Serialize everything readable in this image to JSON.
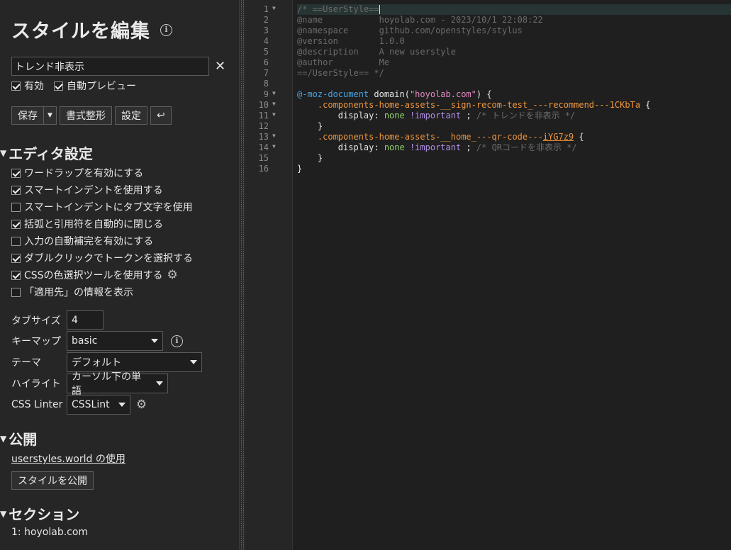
{
  "sidebar": {
    "title": "スタイルを編集",
    "name_value": "トレンド非表示",
    "toggles": [
      {
        "label": "有効",
        "checked": true
      },
      {
        "label": "自動プレビュー",
        "checked": true
      }
    ],
    "buttons": {
      "save": "保存",
      "beautify": "書式整形",
      "settings": "設定",
      "undo": "↩"
    },
    "editor_settings": {
      "heading": "エディタ設定",
      "options": [
        {
          "label": "ワードラップを有効にする",
          "checked": true
        },
        {
          "label": "スマートインデントを使用する",
          "checked": true
        },
        {
          "label": "スマートインデントにタブ文字を使用",
          "checked": false
        },
        {
          "label": "括弧と引用符を自動的に閉じる",
          "checked": true
        },
        {
          "label": "入力の自動補完を有効にする",
          "checked": false
        },
        {
          "label": "ダブルクリックでトークンを選択する",
          "checked": true
        },
        {
          "label": "CSSの色選択ツールを使用する",
          "checked": true
        },
        {
          "label": "「適用先」の情報を表示",
          "checked": false
        }
      ],
      "tab_size_label": "タブサイズ",
      "tab_size_value": "4",
      "keymap_label": "キーマップ",
      "keymap_value": "basic",
      "theme_label": "テーマ",
      "theme_value": "デフォルト",
      "highlight_label": "ハイライト",
      "highlight_value": "カーソル下の単語",
      "linter_label": "CSS Linter",
      "linter_value": "CSSLint"
    },
    "publish": {
      "heading": "公開",
      "link": "userstyles.world の使用",
      "button": "スタイルを公開"
    },
    "sections": {
      "heading": "セクション",
      "items": [
        "1: hoyolab.com"
      ]
    }
  },
  "editor": {
    "line_numbers": [
      "1",
      "2",
      "3",
      "4",
      "5",
      "6",
      "7",
      "8",
      "9",
      "10",
      "11",
      "12",
      "13",
      "14",
      "15",
      "16"
    ],
    "fold_lines": [
      1,
      9,
      10,
      11,
      13,
      14
    ],
    "lines": [
      [
        {
          "t": "/* ==UserStyle==",
          "c": "c-com"
        }
      ],
      [
        {
          "t": "@name           hoyolab.com - 2023/10/1 22:08:22",
          "c": "c-com"
        }
      ],
      [
        {
          "t": "@namespace      github.com/openstyles/stylus",
          "c": "c-com"
        }
      ],
      [
        {
          "t": "@version        1.0.0",
          "c": "c-com"
        }
      ],
      [
        {
          "t": "@description    A new userstyle",
          "c": "c-com"
        }
      ],
      [
        {
          "t": "@author         Me",
          "c": "c-com"
        }
      ],
      [
        {
          "t": "==/UserStyle== */",
          "c": "c-com"
        }
      ],
      [],
      [
        {
          "t": "@-moz-document",
          "c": "c-kw"
        },
        {
          "t": " domain(",
          "c": "c-fn"
        },
        {
          "t": "\"hoyolab.com\"",
          "c": "c-str"
        },
        {
          "t": ") {",
          "c": "c-fn"
        }
      ],
      [
        {
          "t": "    ",
          "c": "c-txt"
        },
        {
          "t": ".components-home-assets-__sign-recom-test_---recommend---1CKbTa",
          "c": "c-sel"
        },
        {
          "t": " {",
          "c": "c-txt"
        }
      ],
      [
        {
          "t": "        display",
          "c": "c-prop"
        },
        {
          "t": ": ",
          "c": "c-txt"
        },
        {
          "t": "none",
          "c": "c-val"
        },
        {
          "t": " !important",
          "c": "c-imp"
        },
        {
          "t": " ; ",
          "c": "c-txt"
        },
        {
          "t": "/* トレンドを非表示 */",
          "c": "c-com"
        }
      ],
      [
        {
          "t": "    }",
          "c": "c-txt"
        }
      ],
      [
        {
          "t": "    ",
          "c": "c-txt"
        },
        {
          "t": ".components-home-assets-__home_---qr-code---",
          "c": "c-sel"
        },
        {
          "t": "iYG7z9",
          "c": "c-sel u"
        },
        {
          "t": " {",
          "c": "c-txt"
        }
      ],
      [
        {
          "t": "        display",
          "c": "c-prop"
        },
        {
          "t": ": ",
          "c": "c-txt"
        },
        {
          "t": "none",
          "c": "c-val"
        },
        {
          "t": " !important",
          "c": "c-imp"
        },
        {
          "t": " ; ",
          "c": "c-txt"
        },
        {
          "t": "/* QRコードを非表示 */",
          "c": "c-com"
        }
      ],
      [
        {
          "t": "    }",
          "c": "c-txt"
        }
      ],
      [
        {
          "t": "}",
          "c": "c-txt"
        }
      ]
    ]
  },
  "colors": {
    "background": "#1f1f1f",
    "sidebar": "#262626",
    "comment": "#6b6b6b",
    "keyword": "#4aa3e0",
    "string": "#e48ac2",
    "selector": "#f0963e",
    "value": "#8fd16a",
    "important": "#b08fe6"
  }
}
